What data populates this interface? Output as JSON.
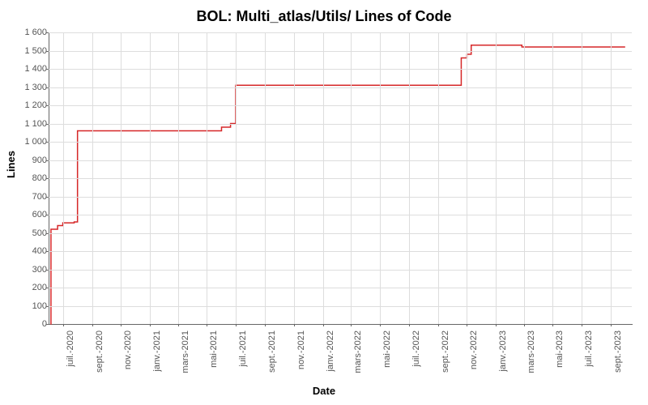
{
  "chart_data": {
    "type": "line",
    "title": "BOL: Multi_atlas/Utils/ Lines of Code",
    "xlabel": "Date",
    "ylabel": "Lines",
    "ylim": [
      0,
      1600
    ],
    "y_ticks": [
      0,
      100,
      200,
      300,
      400,
      500,
      600,
      700,
      800,
      900,
      1000,
      1100,
      1200,
      1300,
      1400,
      1500,
      1600
    ],
    "y_tick_labels": [
      "0",
      "100",
      "200",
      "300",
      "400",
      "500",
      "600",
      "700",
      "800",
      "900",
      "1 000",
      "1 100",
      "1 200",
      "1 300",
      "1 400",
      "1 500",
      "1 600"
    ],
    "x_ticks": [
      "juil.-2020",
      "sept.-2020",
      "nov.-2020",
      "janv.-2021",
      "mars-2021",
      "mai-2021",
      "juil.-2021",
      "sept.-2021",
      "nov.-2021",
      "janv.-2022",
      "mars-2022",
      "mai-2022",
      "juil.-2022",
      "sept.-2022",
      "nov.-2022",
      "janv.-2023",
      "mars-2023",
      "mai-2023",
      "juil.-2023",
      "sept.-2023"
    ],
    "x_range": [
      "2020-06-01",
      "2023-10-15"
    ],
    "series": [
      {
        "name": "Lines of Code",
        "color": "#d62728",
        "points": [
          {
            "x": "2020-06-05",
            "y": 0
          },
          {
            "x": "2020-06-06",
            "y": 520
          },
          {
            "x": "2020-06-20",
            "y": 540
          },
          {
            "x": "2020-07-01",
            "y": 555
          },
          {
            "x": "2020-07-25",
            "y": 560
          },
          {
            "x": "2020-08-01",
            "y": 1060
          },
          {
            "x": "2021-05-25",
            "y": 1060
          },
          {
            "x": "2021-06-01",
            "y": 1080
          },
          {
            "x": "2021-06-20",
            "y": 1100
          },
          {
            "x": "2021-07-01",
            "y": 1310
          },
          {
            "x": "2022-10-15",
            "y": 1310
          },
          {
            "x": "2022-10-20",
            "y": 1460
          },
          {
            "x": "2022-11-01",
            "y": 1480
          },
          {
            "x": "2022-11-10",
            "y": 1530
          },
          {
            "x": "2023-02-20",
            "y": 1530
          },
          {
            "x": "2023-02-25",
            "y": 1520
          },
          {
            "x": "2023-10-01",
            "y": 1520
          }
        ]
      }
    ]
  }
}
